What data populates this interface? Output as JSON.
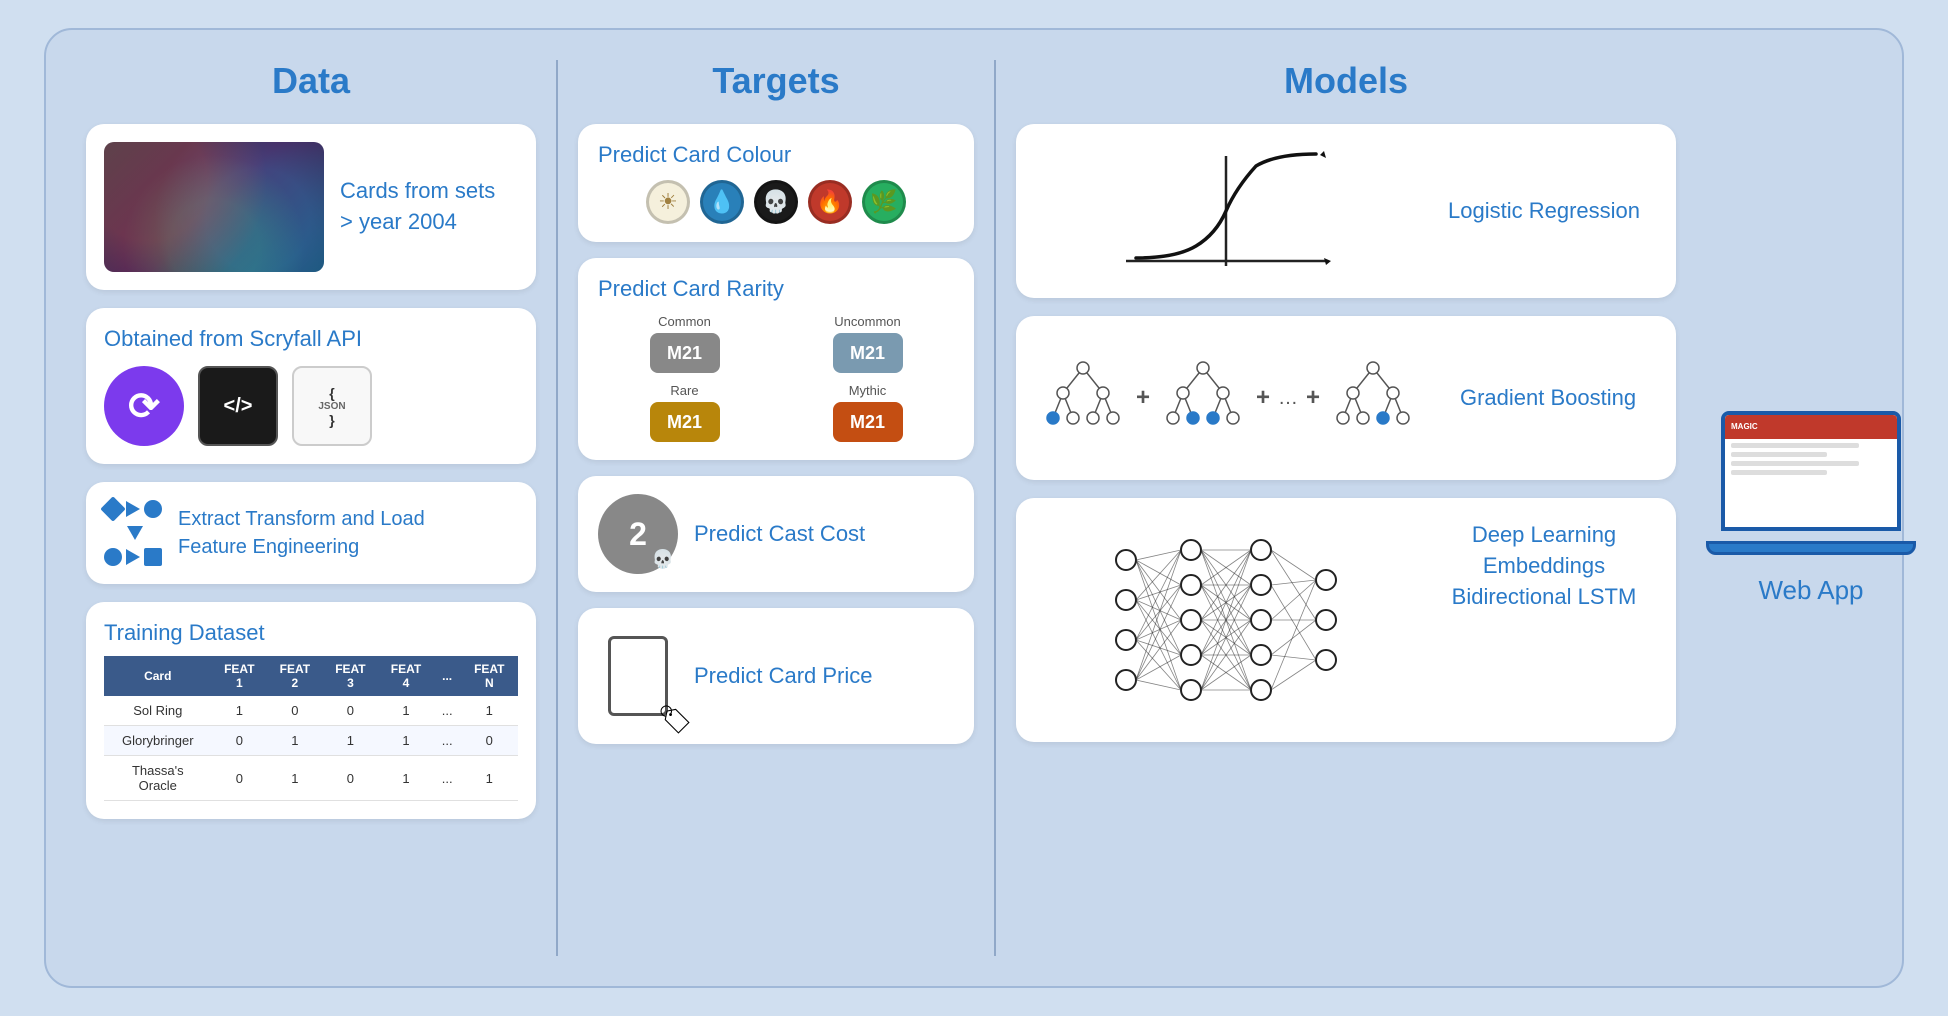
{
  "columns": {
    "data": {
      "header": "Data",
      "cards": {
        "cards_from_sets": {
          "text": "Cards from sets\n> year 2004"
        },
        "scryfall": {
          "title": "Obtained from Scryfall API",
          "icons": [
            "scryfall",
            "code",
            "json"
          ]
        },
        "etl": {
          "line1": "Extract Transform and Load",
          "line2": "Feature Engineering"
        },
        "training": {
          "title": "Training Dataset",
          "columns": [
            "Card",
            "FEAT 1",
            "FEAT 2",
            "FEAT 3",
            "FEAT 4",
            "...",
            "FEAT N"
          ],
          "rows": [
            {
              "card": "Sol Ring",
              "f1": "1",
              "f2": "0",
              "f3": "0",
              "f4": "1",
              "dots": "...",
              "fn": "1"
            },
            {
              "card": "Glorybringer",
              "f1": "0",
              "f2": "1",
              "f3": "1",
              "f4": "1",
              "dots": "...",
              "fn": "0"
            },
            {
              "card": "Thassa's Oracle",
              "f1": "0",
              "f2": "1",
              "f3": "0",
              "f4": "1",
              "dots": "...",
              "fn": "1"
            }
          ]
        }
      }
    },
    "targets": {
      "header": "Targets",
      "cards": {
        "colour": {
          "title": "Predict Card Colour",
          "mana": [
            "white",
            "blue",
            "black",
            "red",
            "green"
          ]
        },
        "rarity": {
          "title": "Predict Card Rarity",
          "rarities": [
            {
              "label": "Common",
              "class": "common"
            },
            {
              "label": "Uncommon",
              "class": "uncommon"
            },
            {
              "label": "Rare",
              "class": "rare"
            },
            {
              "label": "Mythic",
              "class": "mythic"
            }
          ]
        },
        "cast_cost": {
          "title": "Predict Cast Cost",
          "cost_num": "2"
        },
        "price": {
          "title": "Predict Card Price"
        }
      }
    },
    "models": {
      "header": "Models",
      "cards": {
        "logistic": {
          "label": "Logistic Regression"
        },
        "gradient_boosting": {
          "label": "Gradient Boosting"
        },
        "deep_learning": {
          "label": "Deep Learning\nEmbeddings\nBidirectional LSTM"
        }
      }
    },
    "webapp": {
      "label": "Web App"
    }
  }
}
